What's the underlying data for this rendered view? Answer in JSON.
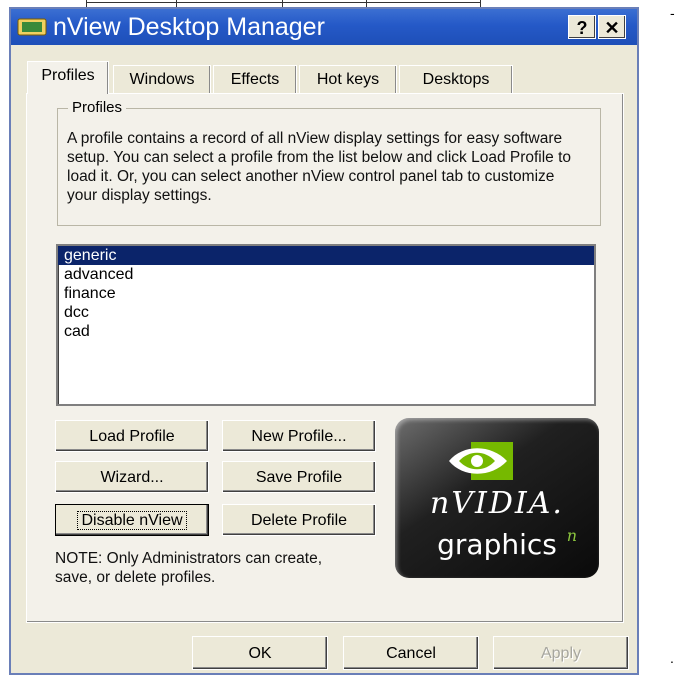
{
  "window": {
    "title": "nView Desktop Manager",
    "help_label": "?",
    "close_label": "✕"
  },
  "tabs": [
    {
      "label": "Profiles",
      "active": true
    },
    {
      "label": "Windows",
      "active": false
    },
    {
      "label": "Effects",
      "active": false
    },
    {
      "label": "Hot keys",
      "active": false
    },
    {
      "label": "Desktops",
      "active": false
    }
  ],
  "profiles_group": {
    "title": "Profiles",
    "description": "A profile contains a record of all nView display settings for easy software setup. You can select a profile from the list below and click Load Profile to load it. Or, you can select another nView control panel tab to customize your display settings."
  },
  "profile_list": {
    "items": [
      "generic",
      "advanced",
      "finance",
      "dcc",
      "cad"
    ],
    "selected_index": 0
  },
  "buttons": {
    "load_profile": "Load Profile",
    "new_profile": "New Profile...",
    "wizard": "Wizard...",
    "save_profile": "Save Profile",
    "disable_nview": "Disable nView",
    "delete_profile": "Delete Profile"
  },
  "note": "NOTE: Only Administrators can create, save, or delete profiles.",
  "logo": {
    "brand": "nVIDIA.",
    "tagline": "graphics",
    "superscript": "n"
  },
  "dialog_buttons": {
    "ok": "OK",
    "cancel": "Cancel",
    "apply": "Apply"
  },
  "margin_marks": {
    "top": "-",
    "bottom": "."
  },
  "colors": {
    "titlebar": "#2559c7",
    "selection": "#0b246a",
    "nvidia_green": "#76b900"
  }
}
